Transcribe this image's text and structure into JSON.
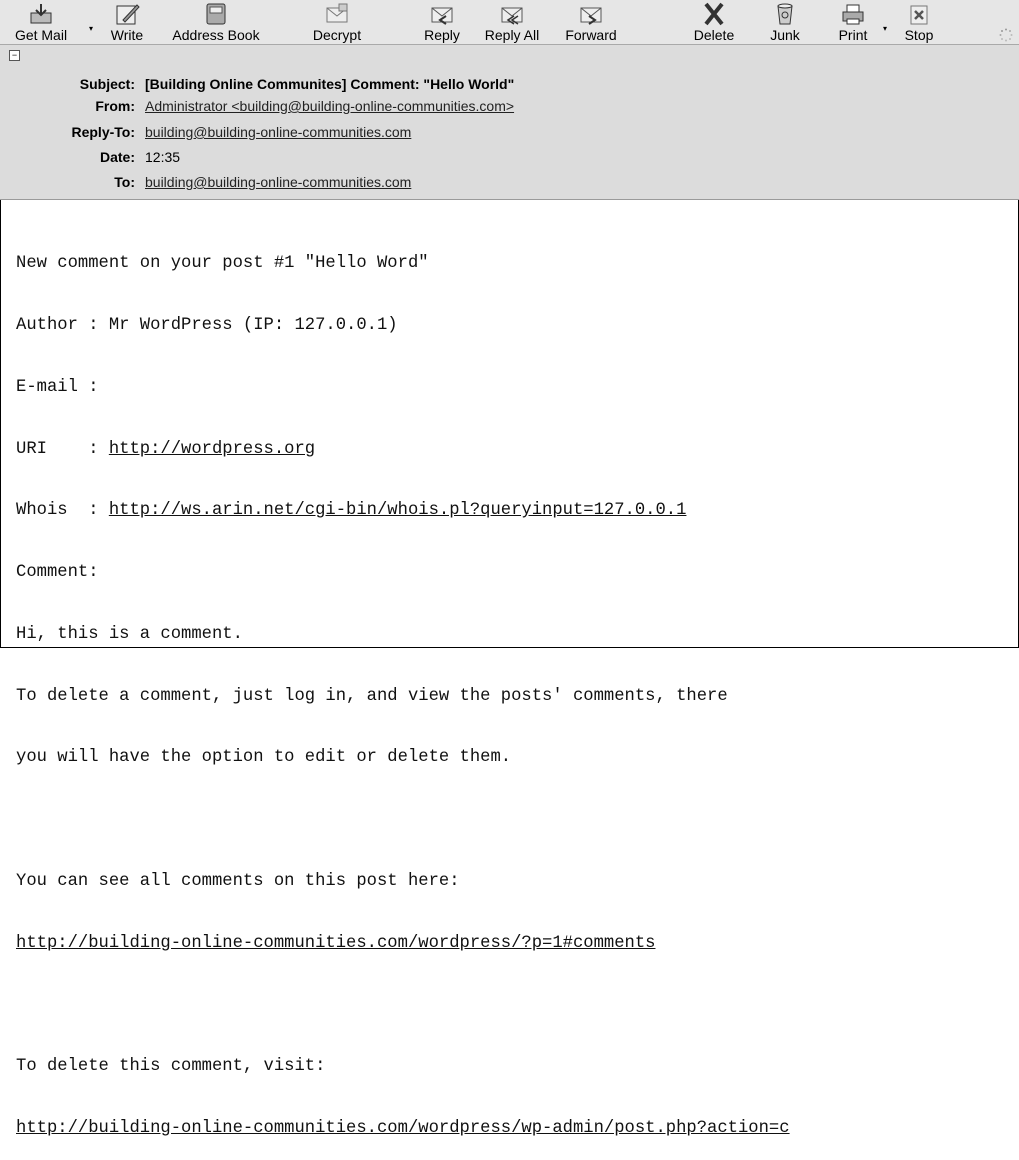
{
  "toolbar": {
    "buttons": [
      {
        "label": "Get Mail",
        "icon": "get-mail-icon",
        "dropdown": true
      },
      {
        "label": "Write",
        "icon": "write-icon"
      },
      {
        "label": "Address Book",
        "icon": "address-book-icon"
      },
      {
        "label": "Decrypt",
        "icon": "decrypt-icon"
      },
      {
        "label": "Reply",
        "icon": "reply-icon"
      },
      {
        "label": "Reply All",
        "icon": "reply-all-icon"
      },
      {
        "label": "Forward",
        "icon": "forward-icon"
      },
      {
        "label": "Delete",
        "icon": "delete-icon"
      },
      {
        "label": "Junk",
        "icon": "junk-icon"
      },
      {
        "label": "Print",
        "icon": "print-icon",
        "dropdown": true
      },
      {
        "label": "Stop",
        "icon": "stop-icon"
      }
    ]
  },
  "headers": {
    "subject_name": "Subject:",
    "subject": "[Building Online Communites] Comment: \"Hello World\"",
    "from_name": "From:",
    "from": "Administrator <building@building-online-communities.com>",
    "replyto_name": "Reply-To:",
    "replyto": "building@building-online-communities.com",
    "date_name": "Date:",
    "date": "12:35",
    "to_name": "To:",
    "to": "building@building-online-communities.com"
  },
  "body": {
    "line1": "New comment on your post #1 \"Hello Word\"",
    "line2": "Author : Mr WordPress (IP: 127.0.0.1)",
    "line3": "E-mail :",
    "line4_label": "URI    : ",
    "line4_link": "http://wordpress.org",
    "line5_label": "Whois  : ",
    "line5_link": "http://ws.arin.net/cgi-bin/whois.pl?queryinput=127.0.0.1",
    "line6": "Comment:",
    "line7": "Hi, this is a comment.",
    "line8": "To delete a comment, just log in, and view the posts' comments, there",
    "line9": "you will have the option to edit or delete them.",
    "line11": "You can see all comments on this post here:",
    "line12_link": "http://building-online-communities.com/wordpress/?p=1#comments",
    "line14": "To delete this comment, visit:",
    "line15_link": "http://building-online-communities.com/wordpress/wp-admin/post.php?action=c"
  }
}
